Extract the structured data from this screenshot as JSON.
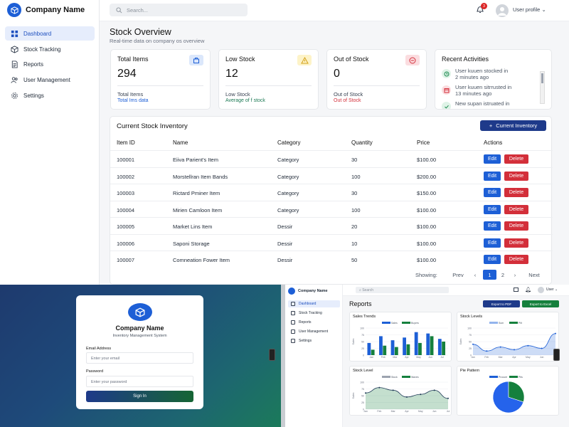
{
  "app": {
    "company": "Company Name",
    "sidebar": [
      {
        "label": "Dashboard",
        "icon": "dashboard-icon"
      },
      {
        "label": "Stock Tracking",
        "icon": "box-icon"
      },
      {
        "label": "Reports",
        "icon": "document-icon"
      },
      {
        "label": "User Management",
        "icon": "users-icon"
      },
      {
        "label": "Settings",
        "icon": "gear-icon"
      }
    ],
    "search_placeholder": "Search...",
    "notification_count": "3",
    "user_profile": "User profile",
    "title": "Stock Overview",
    "subtitle": "Real-time data on company os overview",
    "stats": [
      {
        "label": "Total Items",
        "value": "294",
        "footer": "Total Items",
        "note": "Total Ims data",
        "note_color": "#1d5fd6",
        "icon_bg": "#dbe7fb",
        "icon_color": "#1d5fd6",
        "icon": "box-icon"
      },
      {
        "label": "Low Stock",
        "value": "12",
        "footer": "Low Stock",
        "note": "Average of f stock",
        "note_color": "#1d7a55",
        "icon_bg": "#fdf3c8",
        "icon_color": "#d4a017",
        "icon": "warning-icon"
      },
      {
        "label": "Out of Stock",
        "value": "0",
        "footer": "Out of Stock",
        "note": "Out of Stock",
        "note_color": "#d32f3a",
        "icon_bg": "#fbdde0",
        "icon_color": "#d32f3a",
        "icon": "minus-circle-icon"
      }
    ],
    "activities_title": "Recent Activities",
    "activities": [
      {
        "line1": "User kuuen stocked in",
        "line2": "2 minutes ago",
        "color": "#1b8a4f",
        "bg": "#dff3e7"
      },
      {
        "line1": "User kuuen sitrrusted in",
        "line2": "13 minutes ago",
        "color": "#d32f3a",
        "bg": "#fbdde0"
      },
      {
        "line1": "New supan istruated in",
        "line2": "",
        "color": "#1b8a4f",
        "bg": "#dff3e7"
      }
    ],
    "inventory_title": "Current Stock Inventory",
    "inventory_button": "Current Inventory",
    "columns": [
      "Item ID",
      "Name",
      "Category",
      "Quantity",
      "Price",
      "Actions"
    ],
    "rows": [
      [
        "100001",
        "Eiiva Parient's Item",
        "Category",
        "30",
        "$100.00"
      ],
      [
        "100002",
        "Morstellran Item Bands",
        "Category",
        "100",
        "$200.00"
      ],
      [
        "100003",
        "Rictard Pminer Item",
        "Category",
        "30",
        "$150.00"
      ],
      [
        "100004",
        "Mirien Camloon Item",
        "Category",
        "100",
        "$100.00"
      ],
      [
        "100005",
        "Market Lins Item",
        "Dessir",
        "20",
        "$100.00"
      ],
      [
        "100006",
        "Saponi Storage",
        "Dessir",
        "10",
        "$100.00"
      ],
      [
        "100007",
        "Comneation Fower Item",
        "Dessir",
        "50",
        "$100.00"
      ]
    ],
    "edit_label": "Edit",
    "delete_label": "Delete",
    "pagination": {
      "showing": "Showing:",
      "prev": "Prev",
      "page1": "1",
      "page2": "2",
      "next": "Next"
    }
  },
  "login": {
    "company": "Company Name",
    "subtitle": "Inventory Management System",
    "email_label": "Email Address",
    "email_placeholder": "Enter your email",
    "password_label": "Password",
    "password_placeholder": "Enter your password",
    "signin": "Sign In"
  },
  "reports": {
    "company": "Company Name",
    "search": "Search",
    "user": "User",
    "sidebar": [
      "Dashboard",
      "Stock Tracking",
      "Reports",
      "User Management",
      "Settings"
    ],
    "title": "Reports",
    "export_pdf": "Export to PDF",
    "export_excel": "Export to Excel",
    "charts": {
      "sales": {
        "title": "Sales Trends",
        "legend": [
          "Sales",
          "Buyers"
        ],
        "ylabel": "Sales"
      },
      "levels": {
        "title": "Stock Levels",
        "legend": [
          "Sum",
          "Pilt"
        ],
        "ylabel": "Sales"
      },
      "level": {
        "title": "Stock Level",
        "legend": [
          "Stock",
          "Waves"
        ],
        "ylabel": "Sales"
      },
      "pie": {
        "title": "Pie Pattern",
        "legend": [
          "Procure",
          "Pits"
        ]
      }
    }
  },
  "chart_data": [
    {
      "type": "bar",
      "title": "Sales Trends",
      "ylabel": "Sales",
      "categories": [
        "Jan",
        "Feb",
        "Mar",
        "Apr",
        "May",
        "Jun",
        "Jul"
      ],
      "ylim": [
        0,
        100
      ],
      "series": [
        {
          "name": "Sales",
          "values": [
            45,
            70,
            55,
            65,
            85,
            80,
            60
          ]
        },
        {
          "name": "Buyers",
          "values": [
            20,
            35,
            30,
            40,
            45,
            70,
            50
          ]
        }
      ]
    },
    {
      "type": "area",
      "title": "Stock Levels",
      "ylabel": "Sales",
      "categories": [
        "Jan",
        "Feb",
        "Mar",
        "Apr",
        "May",
        "Jun",
        "Jul"
      ],
      "ylim": [
        0,
        100
      ],
      "series": [
        {
          "name": "Sum",
          "values": [
            40,
            15,
            30,
            20,
            35,
            25,
            80
          ]
        }
      ]
    },
    {
      "type": "area",
      "title": "Stock Level",
      "ylabel": "Sales",
      "categories": [
        "Jan",
        "Feb",
        "Mar",
        "Apr",
        "May",
        "Jun",
        "Jul"
      ],
      "ylim": [
        0,
        100
      ],
      "series": [
        {
          "name": "Stock",
          "values": [
            60,
            80,
            70,
            45,
            55,
            70,
            40
          ]
        }
      ]
    },
    {
      "type": "pie",
      "title": "Pie Pattern",
      "series": [
        {
          "name": "Procure",
          "values": [
            70
          ]
        },
        {
          "name": "Pits",
          "values": [
            30
          ]
        }
      ]
    }
  ]
}
